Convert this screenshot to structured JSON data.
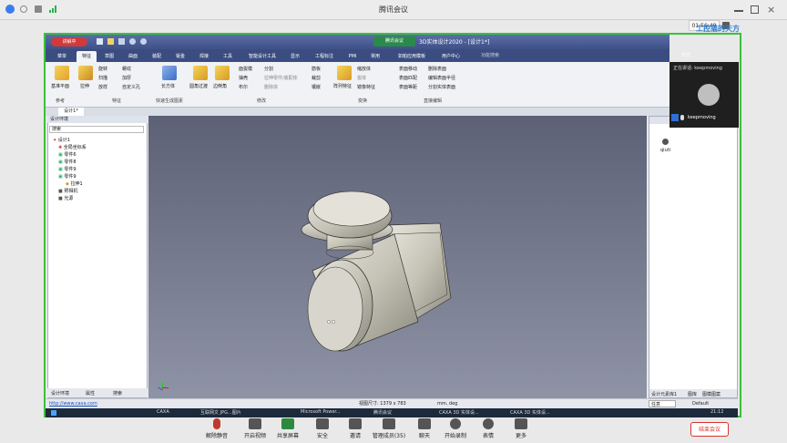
{
  "tencent": {
    "title": "腾讯会议",
    "clock": "01:56:49",
    "watermark": "工控猫的天方"
  },
  "caxa": {
    "title": "3D实体设计2020 - [设计1*]",
    "recording_badge": "讲解中",
    "sharing_badge": "腾讯会议",
    "search_placeholder": "功能搜索",
    "style_label": "样式",
    "tabs": [
      "菜单",
      "特征",
      "草图",
      "曲面",
      "装配",
      "钣金",
      "焊接",
      "工具",
      "智能设计工具",
      "显示",
      "工程标注",
      "PMI",
      "常用",
      "如帕应用模板",
      "用户中心"
    ],
    "ribbon_groups": {
      "group1": {
        "label": "参考",
        "items": [
          "基准平面"
        ]
      },
      "group2": {
        "label": "特征",
        "items": [
          "拉伸",
          "旋转",
          "螺纹",
          "扫描",
          "加厚",
          "放样",
          "自定义孔"
        ]
      },
      "group3": {
        "label": "快速生成图素",
        "items": [
          "长方体"
        ]
      },
      "group4": {
        "label": "修改",
        "items": [
          "圆角过渡",
          "边倒角",
          "面拔模",
          "分割",
          "抽壳",
          "拉伸零件/装配体",
          "布尔",
          "删除体",
          "筋板",
          "裁剪",
          "镶嵌"
        ]
      },
      "group5": {
        "label": "变换",
        "items": [
          "阵列特征",
          "缩放体",
          "拔体",
          "镜像特征"
        ]
      },
      "group6": {
        "label": "直接编辑",
        "items": [
          "表面移动",
          "删除表面",
          "表面匹配",
          "编辑表面半径",
          "表面等距",
          "分割实体表面"
        ]
      }
    },
    "doc_tab": "设计1*",
    "left_panel": {
      "header": "设计环境",
      "search_label": "搜索",
      "tree": [
        "设计1",
        "全局坐标系",
        "零件6",
        "零件8",
        "零件9",
        "零件9",
        "拉伸1",
        "照相机",
        "光源"
      ],
      "bottom_tabs": [
        "设计环境",
        "属性",
        "搜索"
      ]
    },
    "right_panel": {
      "header": "qiuti",
      "bottom_tabs": [
        "设计元素库1",
        "图库",
        "图模图案"
      ],
      "dropdown": "任意",
      "default_label": "Default"
    },
    "status": {
      "url": "http://www.caxa.com",
      "view_size": "视图尺寸: 1379 x 783",
      "units": "mm, deg"
    }
  },
  "speaker": {
    "label": "正在讲话: keepmoving",
    "name": "keepmoving"
  },
  "taskbar": {
    "apps": [
      "CAXA",
      "互联网文 JPG...图片",
      "Microsoft Power...",
      "腾讯会议",
      "CAXA 3D 实体设...",
      "CAXA 3D 实体设..."
    ],
    "time": "21:12"
  },
  "meeting_bar": {
    "buttons": [
      "解除静音",
      "开启视频",
      "共享屏幕",
      "安全",
      "邀请",
      "管理成员(35)",
      "聊天",
      "开始录制",
      "表情",
      "更多"
    ],
    "leave": "结束会议"
  },
  "colors": {
    "frame_green": "#3ac13a",
    "ribbon_blue": "#3b4d80",
    "leave_red": "#d9342b"
  }
}
